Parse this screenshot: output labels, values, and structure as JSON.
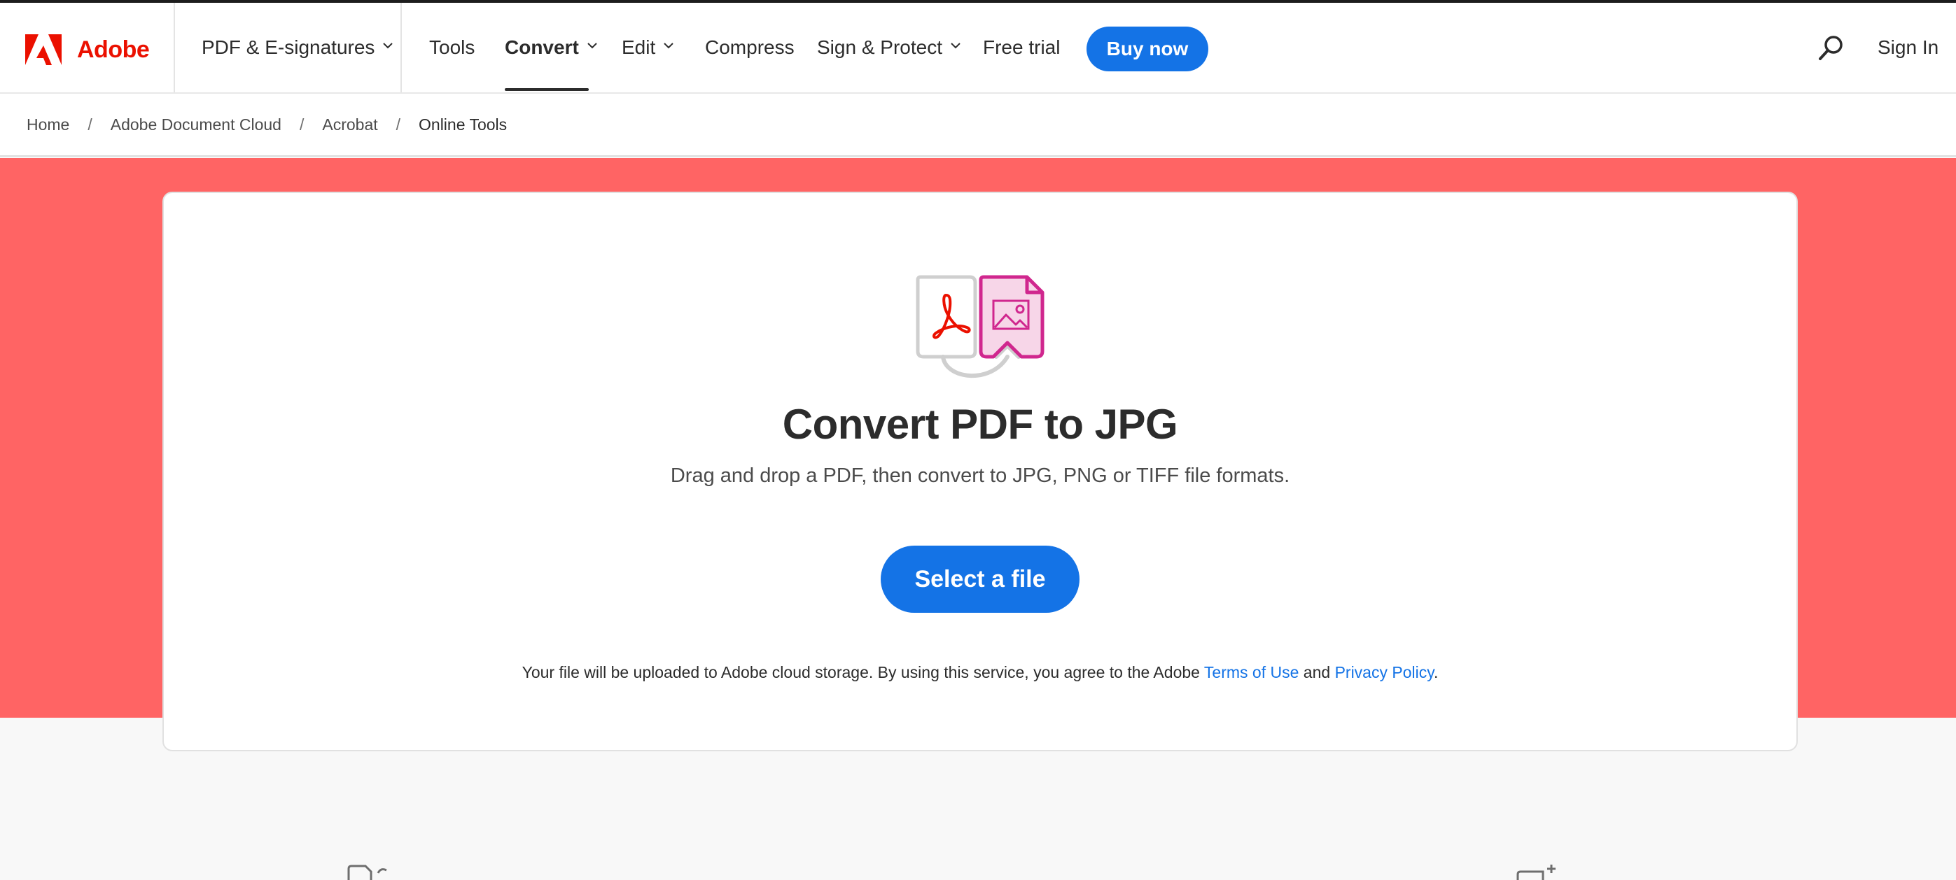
{
  "brand": {
    "name": "Adobe",
    "color": "#eb1000"
  },
  "nav": {
    "product_menu": "PDF & E-signatures",
    "items": [
      {
        "label": "Tools"
      },
      {
        "label": "Convert"
      },
      {
        "label": "Edit"
      },
      {
        "label": "Compress"
      },
      {
        "label": "Sign & Protect"
      },
      {
        "label": "Free trial"
      }
    ],
    "active_item": "Convert",
    "buy_now": "Buy now",
    "sign_in": "Sign In",
    "search_icon": "search-icon",
    "chevron_icon": "chevron-down-icon"
  },
  "breadcrumb": {
    "items": [
      "Home",
      "Adobe Document Cloud",
      "Acrobat",
      "Online Tools"
    ],
    "separator": "/"
  },
  "hero": {
    "title": "Convert PDF to JPG",
    "subtitle": "Drag and drop a PDF, then convert to JPG, PNG or TIFF file formats.",
    "cta": "Select a file",
    "legal_text": "Your file will be uploaded to Adobe cloud storage.  By using this service, you agree to the Adobe ",
    "terms_link": "Terms of Use",
    "and_text": " and ",
    "privacy_link": "Privacy Policy",
    "period": ".",
    "icon": "pdf-to-image-convert-icon"
  },
  "colors": {
    "hero_band": "#ff6464",
    "primary_button": "#1473e6",
    "link": "#1473e6",
    "acrobat_red": "#eb1000",
    "image_pink": "#d0278e"
  }
}
